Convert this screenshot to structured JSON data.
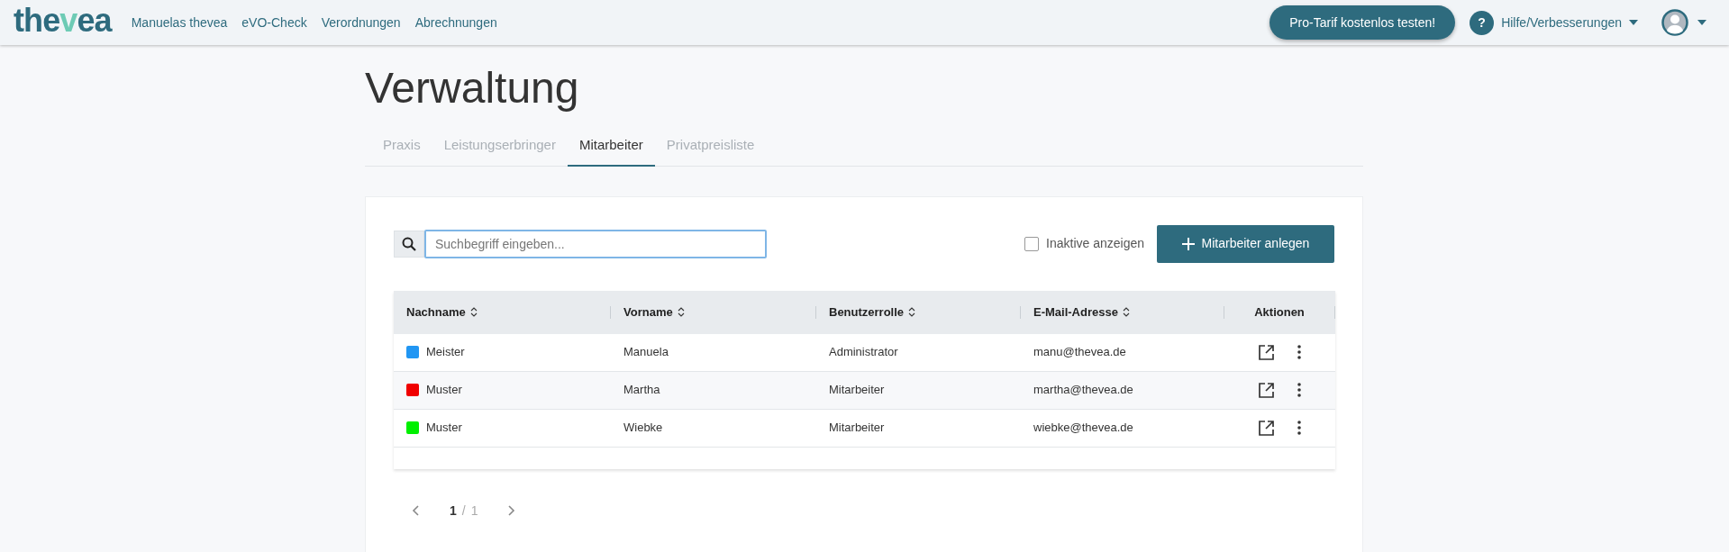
{
  "header": {
    "logo": {
      "before": "the",
      "accent": "v",
      "after": "ea"
    },
    "nav": [
      "Manuelas thevea",
      "eVO-Check",
      "Verordnungen",
      "Abrechnungen"
    ],
    "promo_button": "Pro-Tarif kostenlos testen!",
    "help_icon": "?",
    "help_menu": "Hilfe/Verbesserungen"
  },
  "page_title": "Verwaltung",
  "tabs": [
    {
      "label": "Praxis",
      "selected": false
    },
    {
      "label": "Leistungserbringer",
      "selected": false
    },
    {
      "label": "Mitarbeiter",
      "selected": true
    },
    {
      "label": "Privatpreisliste",
      "selected": false
    }
  ],
  "search": {
    "placeholder": "Suchbegriff eingeben..."
  },
  "show_inactive": {
    "label": "Inaktive anzeigen",
    "checked": false
  },
  "add_button": "Mitarbeiter anlegen",
  "table": {
    "columns": [
      "Nachname",
      "Vorname",
      "Benutzerrolle",
      "E-Mail-Adresse",
      "Aktionen"
    ],
    "rows": [
      {
        "color": "#2196f3",
        "cells": [
          "Meister",
          "Manuela",
          "Administrator",
          "manu@thevea.de"
        ]
      },
      {
        "color": "#f00000",
        "cells": [
          "Muster",
          "Martha",
          "Mitarbeiter",
          "martha@thevea.de"
        ]
      },
      {
        "color": "#00f000",
        "cells": [
          "Muster",
          "Wiebke",
          "Mitarbeiter",
          "wiebke@thevea.de"
        ]
      }
    ]
  },
  "pagination": {
    "current": "1",
    "separator": "/",
    "total": "1"
  }
}
